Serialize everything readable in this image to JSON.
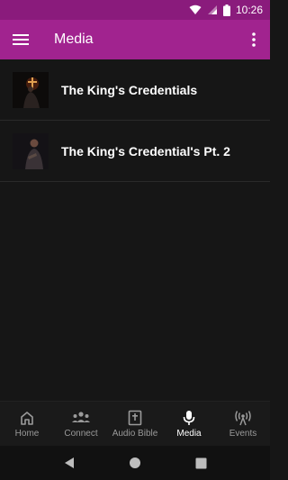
{
  "status_bar": {
    "time": "10:26"
  },
  "app_bar": {
    "title": "Media"
  },
  "media_items": [
    {
      "title": "The King's Credentials"
    },
    {
      "title": "The King's Credential's Pt. 2"
    }
  ],
  "bottom_nav": [
    {
      "label": "Home",
      "icon": "home-icon",
      "active": false
    },
    {
      "label": "Connect",
      "icon": "people-icon",
      "active": false
    },
    {
      "label": "Audio Bible",
      "icon": "bible-icon",
      "active": false
    },
    {
      "label": "Media",
      "icon": "microphone-icon",
      "active": true
    },
    {
      "label": "Events",
      "icon": "broadcast-icon",
      "active": false
    }
  ],
  "colors": {
    "app_bar": "#a1238f",
    "status_bar": "#8a1b7c",
    "background": "#161616"
  }
}
